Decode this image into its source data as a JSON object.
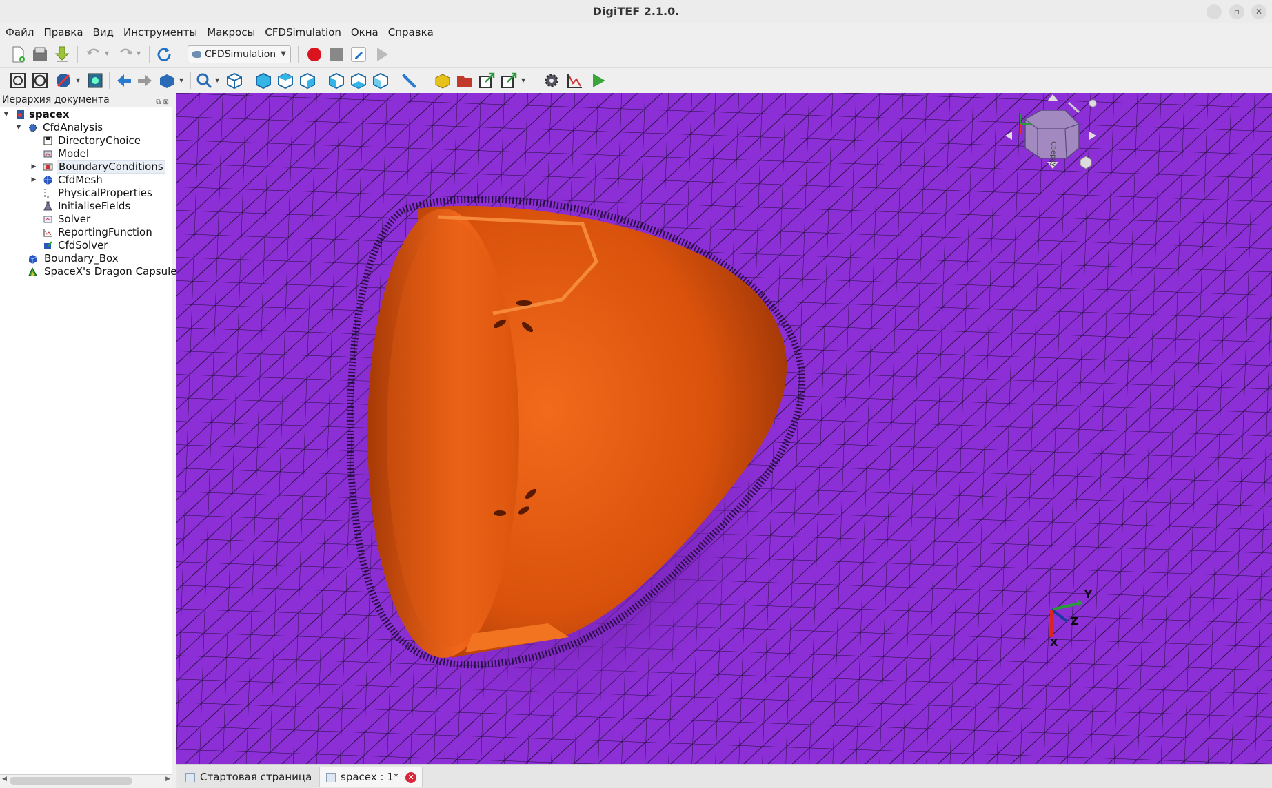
{
  "window": {
    "title": "DigiTEF 2.1.0."
  },
  "menu": [
    "Файл",
    "Правка",
    "Вид",
    "Инструменты",
    "Макросы",
    "CFDSimulation",
    "Окна",
    "Справка"
  ],
  "toolbar": {
    "workbench": "CFDSimulation"
  },
  "tree_panel": {
    "title": "Иерархия документа",
    "items": [
      {
        "label": "spacex",
        "bold": true,
        "icon": "document-icon"
      },
      {
        "label": "CfdAnalysis",
        "icon": "analysis-icon"
      },
      {
        "label": "DirectoryChoice",
        "icon": "save-icon"
      },
      {
        "label": "Model",
        "icon": "model-icon"
      },
      {
        "label": "BoundaryConditions",
        "icon": "boundary-icon",
        "selected": true
      },
      {
        "label": "CfdMesh",
        "icon": "mesh-icon"
      },
      {
        "label": "PhysicalProperties",
        "icon": "physical-icon"
      },
      {
        "label": "InitialiseFields",
        "icon": "flask-icon"
      },
      {
        "label": "Solver",
        "icon": "solver-icon"
      },
      {
        "label": "ReportingFunction",
        "icon": "chart-icon"
      },
      {
        "label": "CfdSolver",
        "icon": "cfdsolver-icon"
      },
      {
        "label": "Boundary_Box",
        "icon": "box-icon"
      },
      {
        "label": "SpaceX's Dragon Capsule (N",
        "icon": "part-icon"
      }
    ]
  },
  "navcube": {
    "face_label": "Сверху"
  },
  "axes": {
    "x": "X",
    "y": "Y",
    "z": "Z"
  },
  "tabs": [
    {
      "label": "Стартовая страница",
      "active": false
    },
    {
      "label": "spacex : 1*",
      "active": true
    }
  ],
  "colors": {
    "viewport": "#8c2fd6",
    "capsule": "#e85a10",
    "mesh": "#1a1030"
  }
}
